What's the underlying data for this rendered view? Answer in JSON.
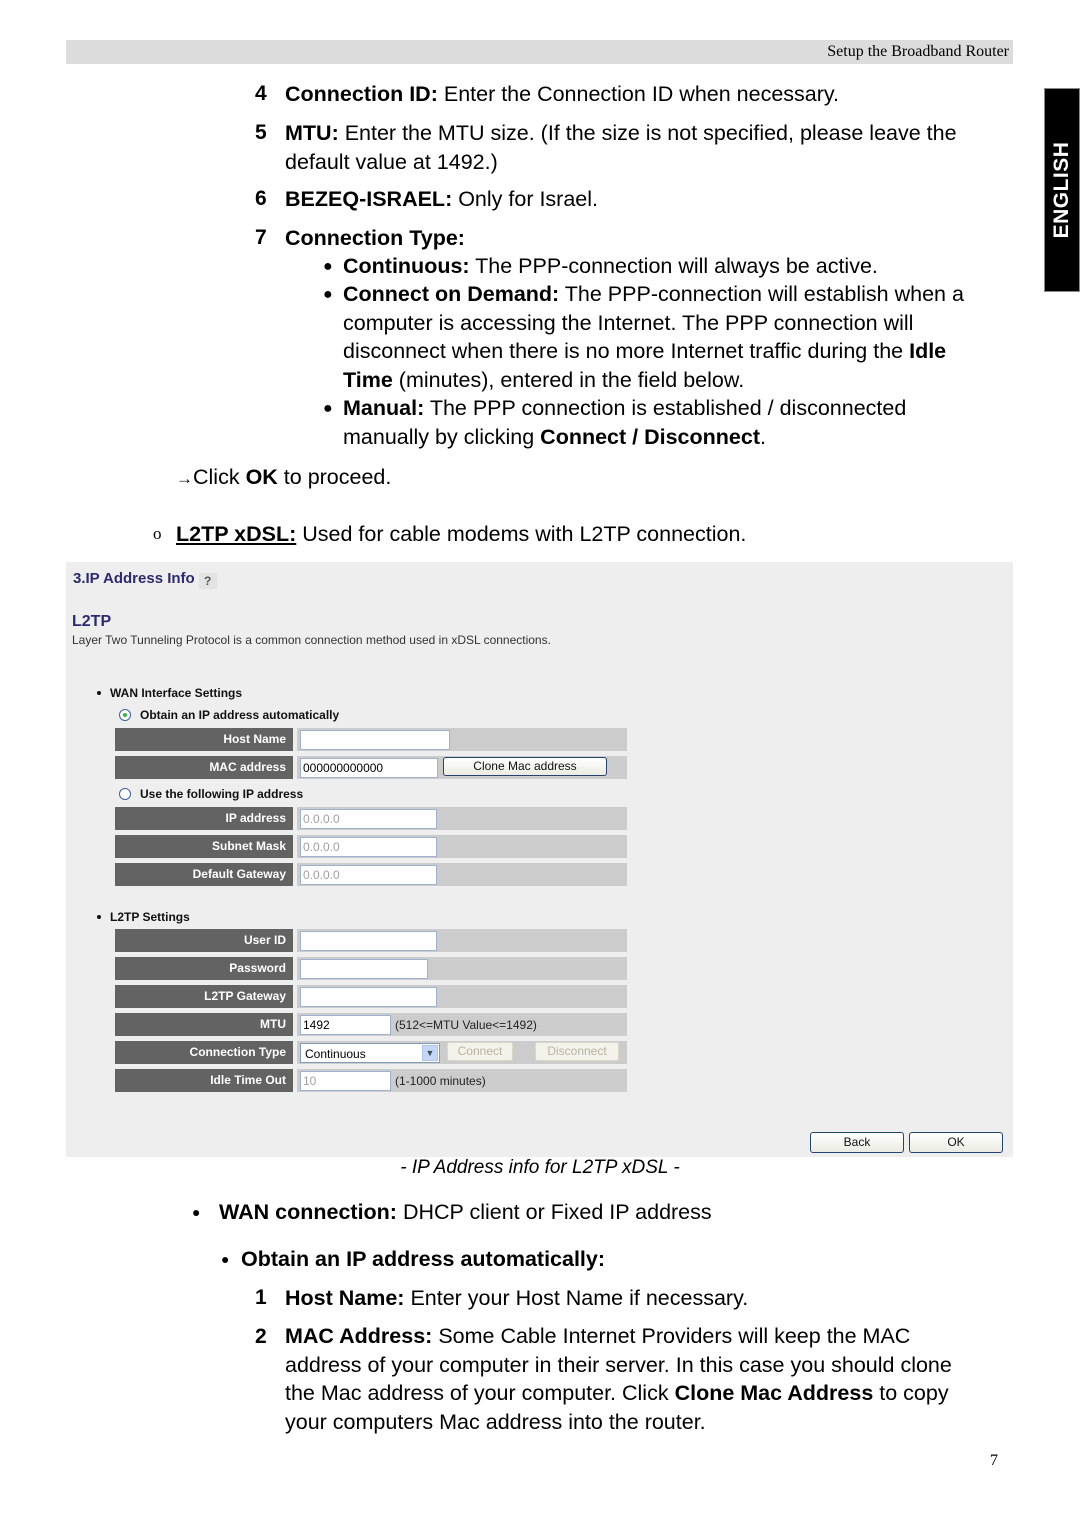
{
  "header": {
    "title": "Setup the Broadband Router"
  },
  "language_tab": "ENGLISH",
  "numbered_items_top": [
    {
      "num": "4",
      "term": "Connection ID:",
      "text": " Enter the Connection ID when necessary."
    },
    {
      "num": "5",
      "term": "MTU:",
      "text": " Enter the MTU size. (If the size is not specified, please leave the",
      "text2": "default value at 1492.)"
    },
    {
      "num": "6",
      "term": "BEZEQ-ISRAEL:",
      "text": " Only for Israel."
    },
    {
      "num": "7",
      "term": "Connection Type:",
      "text": ""
    }
  ],
  "connection_types": [
    {
      "term": "Continuous:",
      "lines": [
        " The PPP-connection will always be active."
      ]
    },
    {
      "term": "Connect on Demand:",
      "lines": [
        " The PPP-connection will establish when a",
        "computer is accessing the Internet. The PPP connection will",
        "disconnect when there is no more Internet traffic during the ",
        "(minutes), entered in the field below."
      ],
      "bold_idle": "Idle",
      "bold_time": "Time"
    },
    {
      "term": "Manual:",
      "lines": [
        " The PPP connection is established / disconnected",
        "manually by clicking "
      ],
      "bold_end": "Connect / Disconnect",
      "end": "."
    }
  ],
  "proceed": {
    "arrow": "→",
    "pre": "Click ",
    "bold": "OK",
    "post": " to proceed."
  },
  "l2tp_intro": {
    "marker": "o",
    "term": "L2TP xDSL:",
    "text": " Used for cable modems with L2TP connection."
  },
  "panel": {
    "title": "3.IP Address Info",
    "help_icon": "?",
    "subtitle": "L2TP",
    "description": "Layer Two Tunneling Protocol is a common connection method used in xDSL connections.",
    "wan_section": "WAN Interface Settings",
    "radio_auto": {
      "label": "Obtain an IP address automatically",
      "checked": true
    },
    "host_name": {
      "label": "Host Name",
      "value": ""
    },
    "mac_address": {
      "label": "MAC address",
      "value": "000000000000",
      "button": "Clone Mac address"
    },
    "radio_fixed": {
      "label": "Use the following IP address",
      "checked": false
    },
    "ip_address": {
      "label": "IP address",
      "value": "0.0.0.0"
    },
    "subnet_mask": {
      "label": "Subnet Mask",
      "value": "0.0.0.0"
    },
    "default_gateway": {
      "label": "Default Gateway",
      "value": "0.0.0.0"
    },
    "l2tp_section": "L2TP Settings",
    "user_id": {
      "label": "User ID",
      "value": ""
    },
    "password": {
      "label": "Password",
      "value": ""
    },
    "l2tp_gateway": {
      "label": "L2TP Gateway",
      "value": ""
    },
    "mtu": {
      "label": "MTU",
      "value": "1492",
      "hint": "(512<=MTU Value<=1492)"
    },
    "connection_type": {
      "label": "Connection Type",
      "selected": "Continuous",
      "connect": "Connect",
      "disconnect": "Disconnect"
    },
    "idle_time": {
      "label": "Idle Time Out",
      "value": "10",
      "hint": "(1-1000 minutes)"
    },
    "back_button": "Back",
    "ok_button": "OK"
  },
  "caption": "- IP Address info for L2TP xDSL -",
  "wan_connection": {
    "term": "WAN connection:",
    "text": " DHCP client or Fixed IP address"
  },
  "obtain_auto": "Obtain an IP address automatically:",
  "numbered_items_bottom": [
    {
      "num": "1",
      "term": "Host Name:",
      "text": " Enter your Host Name if necessary."
    },
    {
      "num": "2",
      "term": "MAC Address:",
      "lines": [
        " Some Cable Internet Providers will keep the MAC",
        "address of your computer in their server. In this case you should clone",
        "the Mac address of your computer. Click "
      ],
      "bold": "Clone Mac Address",
      "after": " to copy",
      "last": "your computers Mac address into the router."
    }
  ],
  "page_number": "7"
}
